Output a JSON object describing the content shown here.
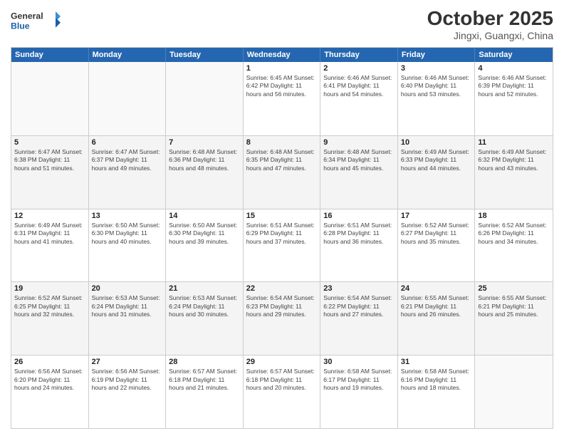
{
  "logo": {
    "line1": "General",
    "line2": "Blue"
  },
  "title": "October 2025",
  "location": "Jingxi, Guangxi, China",
  "days_of_week": [
    "Sunday",
    "Monday",
    "Tuesday",
    "Wednesday",
    "Thursday",
    "Friday",
    "Saturday"
  ],
  "weeks": [
    [
      {
        "day": "",
        "info": ""
      },
      {
        "day": "",
        "info": ""
      },
      {
        "day": "",
        "info": ""
      },
      {
        "day": "1",
        "info": "Sunrise: 6:45 AM\nSunset: 6:42 PM\nDaylight: 11 hours\nand 56 minutes."
      },
      {
        "day": "2",
        "info": "Sunrise: 6:46 AM\nSunset: 6:41 PM\nDaylight: 11 hours\nand 54 minutes."
      },
      {
        "day": "3",
        "info": "Sunrise: 6:46 AM\nSunset: 6:40 PM\nDaylight: 11 hours\nand 53 minutes."
      },
      {
        "day": "4",
        "info": "Sunrise: 6:46 AM\nSunset: 6:39 PM\nDaylight: 11 hours\nand 52 minutes."
      }
    ],
    [
      {
        "day": "5",
        "info": "Sunrise: 6:47 AM\nSunset: 6:38 PM\nDaylight: 11 hours\nand 51 minutes."
      },
      {
        "day": "6",
        "info": "Sunrise: 6:47 AM\nSunset: 6:37 PM\nDaylight: 11 hours\nand 49 minutes."
      },
      {
        "day": "7",
        "info": "Sunrise: 6:48 AM\nSunset: 6:36 PM\nDaylight: 11 hours\nand 48 minutes."
      },
      {
        "day": "8",
        "info": "Sunrise: 6:48 AM\nSunset: 6:35 PM\nDaylight: 11 hours\nand 47 minutes."
      },
      {
        "day": "9",
        "info": "Sunrise: 6:48 AM\nSunset: 6:34 PM\nDaylight: 11 hours\nand 45 minutes."
      },
      {
        "day": "10",
        "info": "Sunrise: 6:49 AM\nSunset: 6:33 PM\nDaylight: 11 hours\nand 44 minutes."
      },
      {
        "day": "11",
        "info": "Sunrise: 6:49 AM\nSunset: 6:32 PM\nDaylight: 11 hours\nand 43 minutes."
      }
    ],
    [
      {
        "day": "12",
        "info": "Sunrise: 6:49 AM\nSunset: 6:31 PM\nDaylight: 11 hours\nand 41 minutes."
      },
      {
        "day": "13",
        "info": "Sunrise: 6:50 AM\nSunset: 6:30 PM\nDaylight: 11 hours\nand 40 minutes."
      },
      {
        "day": "14",
        "info": "Sunrise: 6:50 AM\nSunset: 6:30 PM\nDaylight: 11 hours\nand 39 minutes."
      },
      {
        "day": "15",
        "info": "Sunrise: 6:51 AM\nSunset: 6:29 PM\nDaylight: 11 hours\nand 37 minutes."
      },
      {
        "day": "16",
        "info": "Sunrise: 6:51 AM\nSunset: 6:28 PM\nDaylight: 11 hours\nand 36 minutes."
      },
      {
        "day": "17",
        "info": "Sunrise: 6:52 AM\nSunset: 6:27 PM\nDaylight: 11 hours\nand 35 minutes."
      },
      {
        "day": "18",
        "info": "Sunrise: 6:52 AM\nSunset: 6:26 PM\nDaylight: 11 hours\nand 34 minutes."
      }
    ],
    [
      {
        "day": "19",
        "info": "Sunrise: 6:52 AM\nSunset: 6:25 PM\nDaylight: 11 hours\nand 32 minutes."
      },
      {
        "day": "20",
        "info": "Sunrise: 6:53 AM\nSunset: 6:24 PM\nDaylight: 11 hours\nand 31 minutes."
      },
      {
        "day": "21",
        "info": "Sunrise: 6:53 AM\nSunset: 6:24 PM\nDaylight: 11 hours\nand 30 minutes."
      },
      {
        "day": "22",
        "info": "Sunrise: 6:54 AM\nSunset: 6:23 PM\nDaylight: 11 hours\nand 29 minutes."
      },
      {
        "day": "23",
        "info": "Sunrise: 6:54 AM\nSunset: 6:22 PM\nDaylight: 11 hours\nand 27 minutes."
      },
      {
        "day": "24",
        "info": "Sunrise: 6:55 AM\nSunset: 6:21 PM\nDaylight: 11 hours\nand 26 minutes."
      },
      {
        "day": "25",
        "info": "Sunrise: 6:55 AM\nSunset: 6:21 PM\nDaylight: 11 hours\nand 25 minutes."
      }
    ],
    [
      {
        "day": "26",
        "info": "Sunrise: 6:56 AM\nSunset: 6:20 PM\nDaylight: 11 hours\nand 24 minutes."
      },
      {
        "day": "27",
        "info": "Sunrise: 6:56 AM\nSunset: 6:19 PM\nDaylight: 11 hours\nand 22 minutes."
      },
      {
        "day": "28",
        "info": "Sunrise: 6:57 AM\nSunset: 6:18 PM\nDaylight: 11 hours\nand 21 minutes."
      },
      {
        "day": "29",
        "info": "Sunrise: 6:57 AM\nSunset: 6:18 PM\nDaylight: 11 hours\nand 20 minutes."
      },
      {
        "day": "30",
        "info": "Sunrise: 6:58 AM\nSunset: 6:17 PM\nDaylight: 11 hours\nand 19 minutes."
      },
      {
        "day": "31",
        "info": "Sunrise: 6:58 AM\nSunset: 6:16 PM\nDaylight: 11 hours\nand 18 minutes."
      },
      {
        "day": "",
        "info": ""
      }
    ]
  ]
}
